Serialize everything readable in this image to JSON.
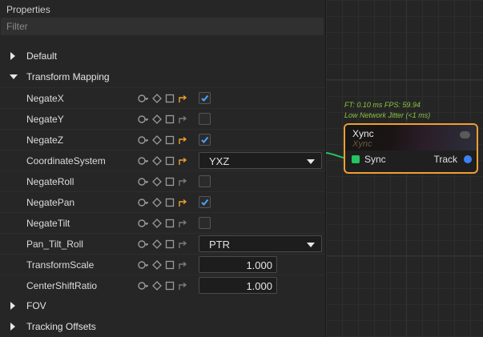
{
  "panel": {
    "title": "Properties",
    "filter_placeholder": "Filter"
  },
  "sections": {
    "default": "Default",
    "transform_mapping": "Transform Mapping",
    "fov": "FOV",
    "tracking_offsets": "Tracking Offsets"
  },
  "props": [
    {
      "label": "NegateX",
      "type": "checkbox",
      "checked": true,
      "linked": true
    },
    {
      "label": "NegateY",
      "type": "checkbox",
      "checked": false,
      "linked": false
    },
    {
      "label": "NegateZ",
      "type": "checkbox",
      "checked": true,
      "linked": true
    },
    {
      "label": "CoordinateSystem",
      "type": "dropdown",
      "value": "YXZ",
      "linked": true
    },
    {
      "label": "NegateRoll",
      "type": "checkbox",
      "checked": false,
      "linked": false
    },
    {
      "label": "NegatePan",
      "type": "checkbox",
      "checked": true,
      "linked": true
    },
    {
      "label": "NegateTilt",
      "type": "checkbox",
      "checked": false,
      "linked": false
    },
    {
      "label": "Pan_Tilt_Roll",
      "type": "dropdown",
      "value": "PTR",
      "linked": false
    },
    {
      "label": "TransformScale",
      "type": "number",
      "value": "1.000",
      "linked": false
    },
    {
      "label": "CenterShiftRatio",
      "type": "number",
      "value": "1.000",
      "linked": false
    }
  ],
  "node": {
    "status_line1": "FT: 0.10 ms FPS: 59.94",
    "status_line2": "Low Network Jitter (<1 ms)",
    "title": "Xync",
    "subtitle": "Xync",
    "input_port": "Sync",
    "output_port": "Track"
  },
  "colors": {
    "accent_orange": "#f0a030",
    "checkbox_tick": "#4aa3ff",
    "status_green": "#8cc63f",
    "port_sync": "#22c55e",
    "port_track": "#3b82f6"
  },
  "icons": [
    "key-icon",
    "diamond-icon",
    "square-icon",
    "link-arrow-icon",
    "check-icon",
    "chevron-right-icon",
    "chevron-down-icon"
  ]
}
